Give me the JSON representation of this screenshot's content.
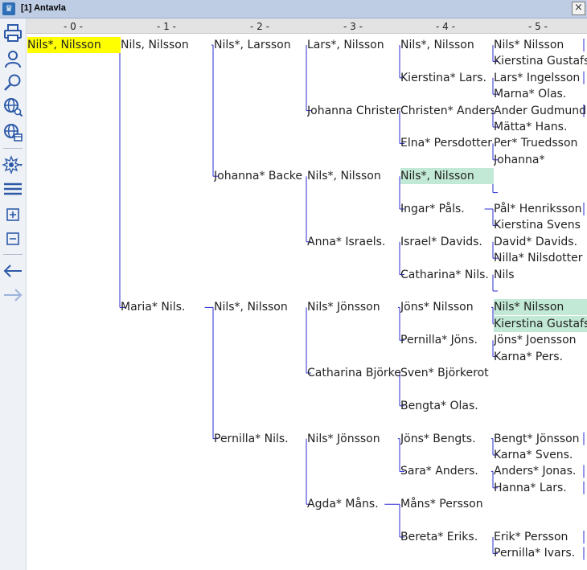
{
  "window": {
    "title": "[1] Antavla",
    "close_label": "×"
  },
  "toolbar": {
    "tools": [
      {
        "name": "print-icon"
      },
      {
        "name": "person-icon"
      },
      {
        "name": "search-icon"
      },
      {
        "name": "web-search-icon"
      },
      {
        "name": "web-window-icon"
      },
      {
        "name": "highlight-icon"
      },
      {
        "name": "menu-lines-icon"
      },
      {
        "name": "expand-plus-icon"
      },
      {
        "name": "collapse-minus-icon"
      },
      {
        "name": "back-arrow-icon"
      },
      {
        "name": "forward-arrow-icon"
      }
    ]
  },
  "generations": [
    "- 0 -",
    "- 1 -",
    "- 2 -",
    "- 3 -",
    "- 4 -",
    "- 5 -"
  ],
  "colors": {
    "selected": "#ffff00",
    "highlight": "#c2e9d5",
    "line": "#2b2bd6"
  },
  "tree": {
    "name": "Nils*, Nilsson",
    "selected": true,
    "children": [
      {
        "name": "Nils, Nilsson",
        "children": [
          {
            "name": "Nils*, Larsson",
            "children": [
              {
                "name": "Lars*, Nilsson",
                "children": [
                  {
                    "name": "Nils*, Nilsson",
                    "children": [
                      {
                        "name": "Nils* Nilsson",
                        "cont": true
                      },
                      {
                        "name": "Kierstina Gustafs"
                      }
                    ]
                  },
                  {
                    "name": "Kierstina* Lars.",
                    "children": [
                      {
                        "name": "Lars* Ingelsson",
                        "cont": true
                      },
                      {
                        "name": "Marna* Olas."
                      }
                    ]
                  }
                ]
              },
              {
                "name": "Johanna Christer",
                "children": [
                  {
                    "name": "Christen* Anders",
                    "children": [
                      {
                        "name": "Ander Gudmund",
                        "cont": true
                      },
                      {
                        "name": "Mätta* Hans."
                      }
                    ]
                  },
                  {
                    "name": "Elna* Persdotter",
                    "children": [
                      {
                        "name": "Per* Truedsson"
                      },
                      {
                        "name": "Johanna*"
                      }
                    ]
                  }
                ]
              }
            ]
          },
          {
            "name": "Johanna* Backe",
            "children": [
              {
                "name": "Nils*, Nilsson",
                "children": [
                  {
                    "name": "Nils*, Nilsson",
                    "highlight": true,
                    "children": [
                      {
                        "name": ""
                      },
                      {
                        "name": ""
                      }
                    ]
                  },
                  {
                    "name": "Ingar* Påls.",
                    "children": [
                      {
                        "name": "Pål* Henriksson",
                        "cont": true
                      },
                      {
                        "name": "Kierstina Svens"
                      }
                    ]
                  }
                ]
              },
              {
                "name": "Anna* Israels.",
                "children": [
                  {
                    "name": "Israel* Davids.",
                    "children": [
                      {
                        "name": "David* Davids."
                      },
                      {
                        "name": "Nilla* Nilsdotter"
                      }
                    ]
                  },
                  {
                    "name": "Catharina* Nils.",
                    "children": [
                      {
                        "name": "Nils"
                      },
                      {
                        "name": ""
                      }
                    ]
                  }
                ]
              }
            ]
          }
        ]
      },
      {
        "name": "Maria* Nils.",
        "children": [
          {
            "name": "Nils*, Nilsson",
            "children": [
              {
                "name": "Nils* Jönsson",
                "children": [
                  {
                    "name": "Jöns* Nilsson",
                    "children": [
                      {
                        "name": "Nils* Nilsson",
                        "highlight": true
                      },
                      {
                        "name": "Kierstina Gustafs",
                        "highlight": true
                      }
                    ]
                  },
                  {
                    "name": "Pernilla* Jöns.",
                    "children": [
                      {
                        "name": "Jöns* Joensson"
                      },
                      {
                        "name": "Karna* Pers."
                      }
                    ]
                  }
                ]
              },
              {
                "name": "Catharina Björke",
                "children": [
                  {
                    "name": "Sven* Björkerot"
                  },
                  {
                    "name": "Bengta* Olas."
                  }
                ]
              }
            ]
          },
          {
            "name": "Pernilla* Nils.",
            "children": [
              {
                "name": "Nils* Jönsson",
                "children": [
                  {
                    "name": "Jöns* Bengts.",
                    "children": [
                      {
                        "name": "Bengt* Jönsson",
                        "cont": true
                      },
                      {
                        "name": "Karna* Svens."
                      }
                    ]
                  },
                  {
                    "name": "Sara* Anders.",
                    "children": [
                      {
                        "name": "Anders* Jonas.",
                        "cont": true
                      },
                      {
                        "name": "Hanna* Lars.",
                        "cont": true
                      }
                    ]
                  }
                ]
              },
              {
                "name": "Agda* Måns.",
                "children": [
                  {
                    "name": "Måns* Persson"
                  },
                  {
                    "name": "Bereta* Eriks.",
                    "children": [
                      {
                        "name": "Erik* Persson",
                        "cont": true
                      },
                      {
                        "name": "Pernilla* Ivars.",
                        "cont": true
                      }
                    ]
                  }
                ]
              }
            ]
          }
        ]
      }
    ]
  }
}
